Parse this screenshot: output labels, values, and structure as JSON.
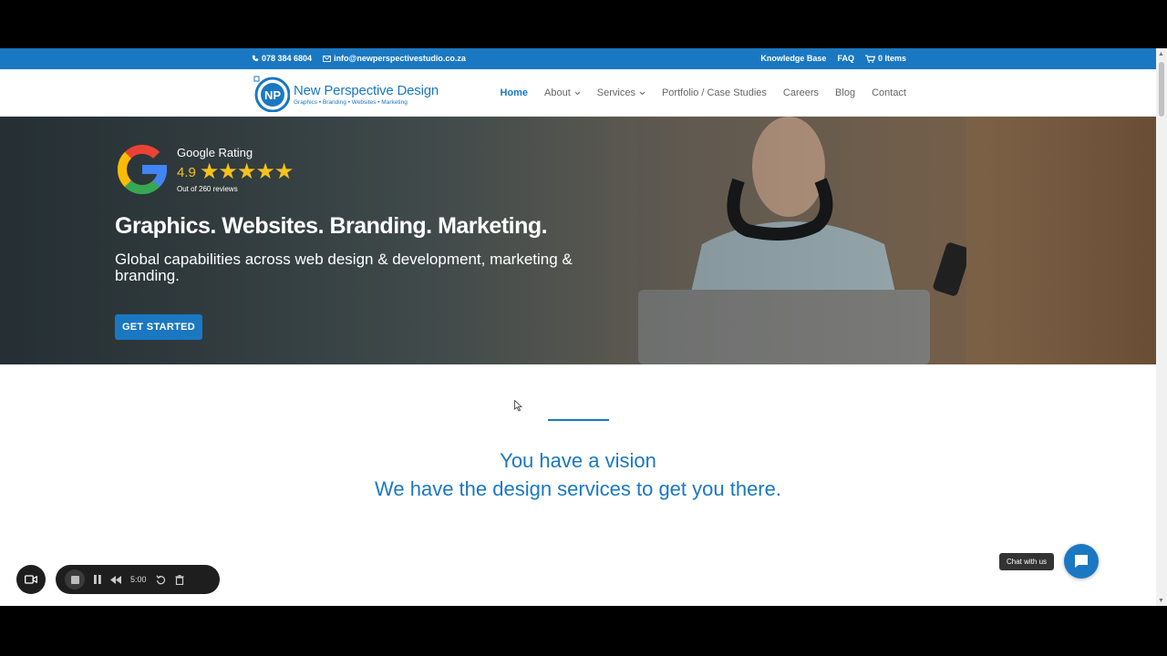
{
  "topbar": {
    "phone": "078 384 6804",
    "email": "info@newperspectivestudio.co.za",
    "knowledge_base": "Knowledge Base",
    "faq": "FAQ",
    "cart": "0 Items"
  },
  "logo": {
    "initials": "NP",
    "name": "New Perspective Design",
    "tagline": "Graphics • Branding • Websites • Marketing"
  },
  "nav": {
    "items": [
      {
        "label": "Home",
        "active": true
      },
      {
        "label": "About",
        "dropdown": true
      },
      {
        "label": "Services",
        "dropdown": true
      },
      {
        "label": "Portfolio / Case Studies"
      },
      {
        "label": "Careers"
      },
      {
        "label": "Blog"
      },
      {
        "label": "Contact"
      }
    ]
  },
  "hero": {
    "rating_label": "Google Rating",
    "rating_value": "4.9",
    "stars": "★★★★★",
    "rating_count": 5,
    "reviews": "Out of 260 reviews",
    "title": "Graphics. Websites. Branding. Marketing.",
    "subtitle": "Global capabilities across web design & development, marketing & branding.",
    "cta": "GET STARTED"
  },
  "section": {
    "line1": "You have a vision",
    "line2": "We have the design services to get you there."
  },
  "chat": {
    "label": "Chat with us"
  },
  "recorder": {
    "time": "5:00"
  },
  "colors": {
    "brand": "#1a78c2",
    "star": "#f6c21c"
  },
  "icons": [
    "phone-icon",
    "email-icon",
    "cart-icon",
    "chevron-down-icon",
    "google-icon",
    "chat-icon",
    "camera-icon",
    "stop-icon",
    "pause-icon",
    "rewind-icon",
    "restart-icon",
    "trash-icon"
  ]
}
